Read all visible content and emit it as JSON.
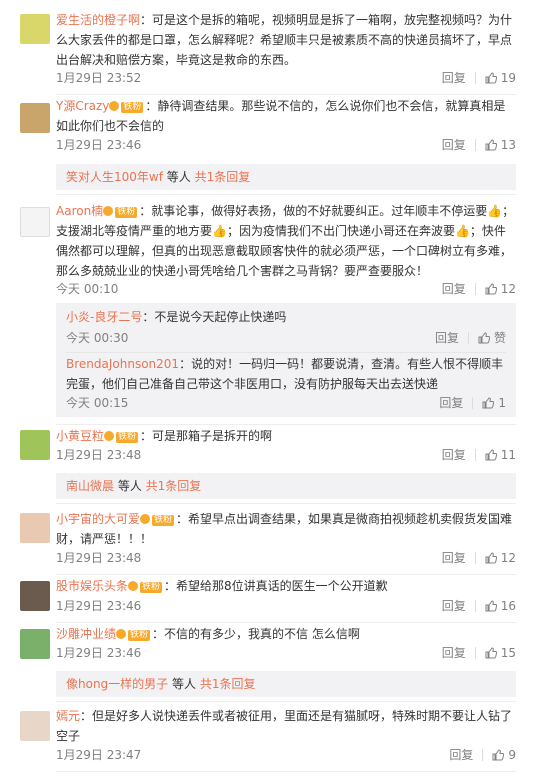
{
  "comments": [
    {
      "user": "爱生活的橙子啊",
      "text": "：可是这个是拆的箱呢，视频明显是拆了一箱啊，放完整视频吗？为什么大家丢件的都是口罩，怎么解释呢？希望顺丰只是被素质不高的快递员搞坏了，早点出台解决和赔偿方案，毕竟这是救命的东西。",
      "time": "1月29日 23:52",
      "reply": "回复",
      "likes": "19"
    },
    {
      "user": "Y源Crazy",
      "badge": "铁粉",
      "text": "：静待调查结果。那些说不信的，怎么说你们也不会信，就算真相是如此你们也不会信的",
      "time": "1月29日 23:46",
      "reply": "回复",
      "likes": "13",
      "more": {
        "user": "笑对人生100年wf",
        "suffix": " 等人 ",
        "count": "共1条回复"
      }
    },
    {
      "user": "Aaron楠",
      "badge": "铁粉",
      "text": "：就事论事，做得好表扬，做的不好就要纠正。过年顺丰不停运要👍；支援湖北等疫情严重的地方要👍；因为疫情我们不出门快递小哥还在奔波要👍；快件偶然都可以理解，但真的出现恶意截取顾客快件的就必须严惩，一个口碑树立有多难，那么多兢兢业业的快递小哥凭啥给几个害群之马背锅？要严查要服众！",
      "time": "今天 00:10",
      "reply": "回复",
      "likes": "12",
      "subs": [
        {
          "user": "小炎-良牙二号",
          "text": "：不是说今天起停止快递吗",
          "time": "今天 00:30",
          "reply": "回复",
          "likes": "赞"
        },
        {
          "user": "BrendaJohnson201",
          "text": "：说的对！一码归一码！都要说清，查清。有些人恨不得顺丰完蛋，他们自己准备自己带这个非医用口，没有防护服每天出去送快递",
          "time": "今天 00:15",
          "reply": "回复",
          "likes": "1"
        }
      ]
    },
    {
      "user": "小黄豆粒",
      "badge": "铁粉",
      "text": "：可是那箱子是拆开的啊",
      "time": "1月29日 23:48",
      "reply": "回复",
      "likes": "11",
      "more": {
        "user": "南山微晨",
        "suffix": " 等人 ",
        "count": "共1条回复"
      }
    },
    {
      "user": "小宇宙的大可爱",
      "badge": "铁粉",
      "text": "：希望早点出调查结果，如果真是微商拍视频趁机卖假货发国难财，请严惩！！！",
      "time": "1月29日 23:48",
      "reply": "回复",
      "likes": "12"
    },
    {
      "user": "股市娱乐头条",
      "badge": "铁粉",
      "text": "：希望给那8位讲真话的医生一个公开道歉",
      "time": "1月29日 23:46",
      "reply": "回复",
      "likes": "16"
    },
    {
      "user": "沙雕冲业绩",
      "badge": "铁粉",
      "text": "：不信的有多少，我真的不信 怎么信啊",
      "time": "1月29日 23:46",
      "reply": "回复",
      "likes": "15",
      "more": {
        "user": "像hong一样的男子",
        "suffix": " 等人 ",
        "count": "共1条回复"
      }
    },
    {
      "user": "嫣元",
      "text": "：但是好多人说快递丢件或者被征用，里面还是有猫腻呀，特殊时期不要让人钻了空子",
      "time": "1月29日 23:47",
      "reply": "回复",
      "likes": "9"
    }
  ],
  "colors": {
    "link": "#eb7350",
    "meta": "#808080",
    "replybg": "#f2f2f5"
  }
}
